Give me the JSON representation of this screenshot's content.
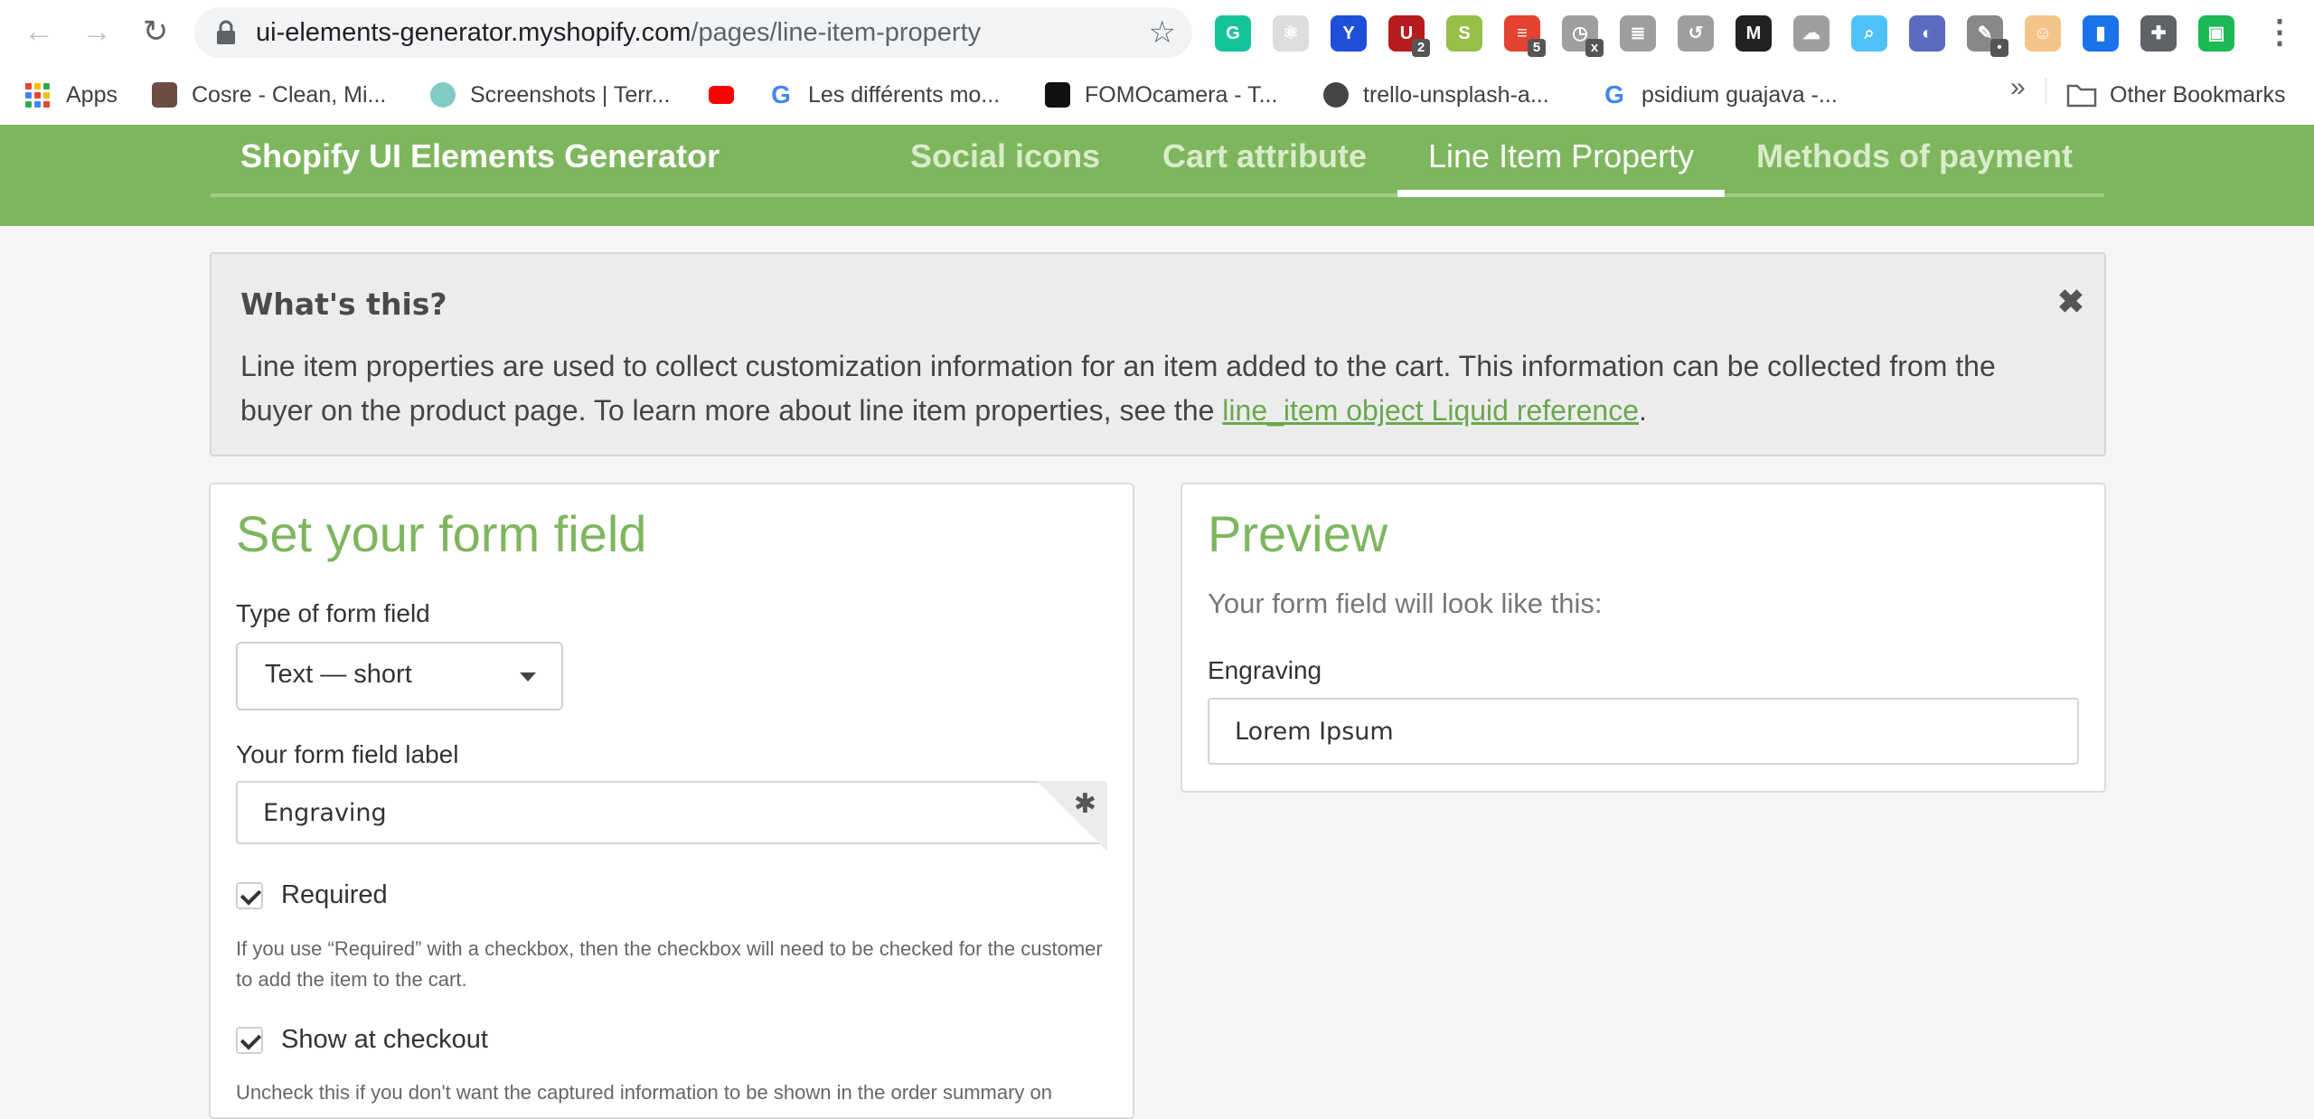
{
  "browser": {
    "url_host": "ui-elements-generator.myshopify.com",
    "url_path": "/pages/line-item-property",
    "extensions": [
      {
        "name": "grammarly-extension",
        "letter": "G",
        "color": "#15c39a",
        "badge": ""
      },
      {
        "name": "react-devtools-extension",
        "letter": "⚛",
        "color": "#dddddd",
        "badge": ""
      },
      {
        "name": "y-extension",
        "letter": "Y",
        "color": "#1f4fd6",
        "badge": ""
      },
      {
        "name": "ublock-extension",
        "letter": "U",
        "color": "#b71c1c",
        "badge": "2"
      },
      {
        "name": "shopify-extension",
        "letter": "S",
        "color": "#95bf47",
        "badge": ""
      },
      {
        "name": "todoist-extension",
        "letter": "≡",
        "color": "#e44332",
        "badge": "5"
      },
      {
        "name": "timer-extension",
        "letter": "◷",
        "color": "#9e9e9e",
        "badge": "x"
      },
      {
        "name": "outline-extension",
        "letter": "≣",
        "color": "#9e9e9e",
        "badge": ""
      },
      {
        "name": "history-extension",
        "letter": "↺",
        "color": "#9e9e9e",
        "badge": ""
      },
      {
        "name": "medium-extension",
        "letter": "M",
        "color": "#222222",
        "badge": ""
      },
      {
        "name": "cloud-extension",
        "letter": "☁",
        "color": "#9e9e9e",
        "badge": ""
      },
      {
        "name": "search-extension",
        "letter": "⌕",
        "color": "#4fc3f7",
        "badge": ""
      },
      {
        "name": "circle-extension",
        "letter": "◐",
        "color": "#5c6bc0",
        "badge": ""
      },
      {
        "name": "eyedropper-extension",
        "letter": "✎",
        "color": "#888888",
        "badge": "•"
      },
      {
        "name": "avatar-extension",
        "letter": "☺",
        "color": "#f4c58a",
        "badge": ""
      },
      {
        "name": "bar-extension",
        "letter": "▮",
        "color": "#1a73e8",
        "badge": ""
      },
      {
        "name": "puzzle-extension",
        "letter": "✚",
        "color": "#5f6368",
        "badge": ""
      },
      {
        "name": "chip-extension",
        "letter": "▣",
        "color": "#1db954",
        "badge": ""
      }
    ],
    "bookmarks": [
      {
        "label": "Apps",
        "color": "#4285f4"
      },
      {
        "label": "Cosre - Clean, Mi...",
        "color": "#6d4c41"
      },
      {
        "label": "Screenshots | Terr...",
        "color": "#80cbc4"
      },
      {
        "label": "",
        "color": "#ff0000"
      },
      {
        "label": "Les différents mo...",
        "color": "#4285f4"
      },
      {
        "label": "FOMOcamera - T...",
        "color": "#111111"
      },
      {
        "label": "trello-unsplash-a...",
        "color": "#444444"
      },
      {
        "label": "psidium guajava -...",
        "color": "#4285f4"
      }
    ],
    "more_label": "»",
    "other_bookmarks": "Other Bookmarks"
  },
  "site": {
    "brand": "Shopify UI Elements Generator",
    "nav": [
      "Social icons",
      "Cart attribute",
      "Line Item Property",
      "Methods of payment"
    ],
    "active_nav": "Line Item Property",
    "accent": "#7eb65e"
  },
  "info": {
    "title": "What's this?",
    "close": "✖",
    "text_before": "Line item properties are used to collect customization information for an item added to the cart. This information can be collected from the buyer on the product page. To learn more about line item properties, see the ",
    "link": "line_item object Liquid reference",
    "text_after": "."
  },
  "form": {
    "title": "Set your form field",
    "type_label": "Type of form field",
    "type_value": "Text — short",
    "field_label_label": "Your form field label",
    "field_label_value": "Engraving",
    "required_label": "Required",
    "required_help": "If you use “Required” with a checkbox, then the checkbox will need to be checked for the customer to add the item to the cart.",
    "show_label": "Show at checkout",
    "show_help": "Uncheck this if you don't want the captured information to be shown in the order summary on"
  },
  "preview": {
    "title": "Preview",
    "subtitle": "Your form field will look like this:",
    "field_label": "Engraving",
    "field_value": "Lorem Ipsum"
  }
}
